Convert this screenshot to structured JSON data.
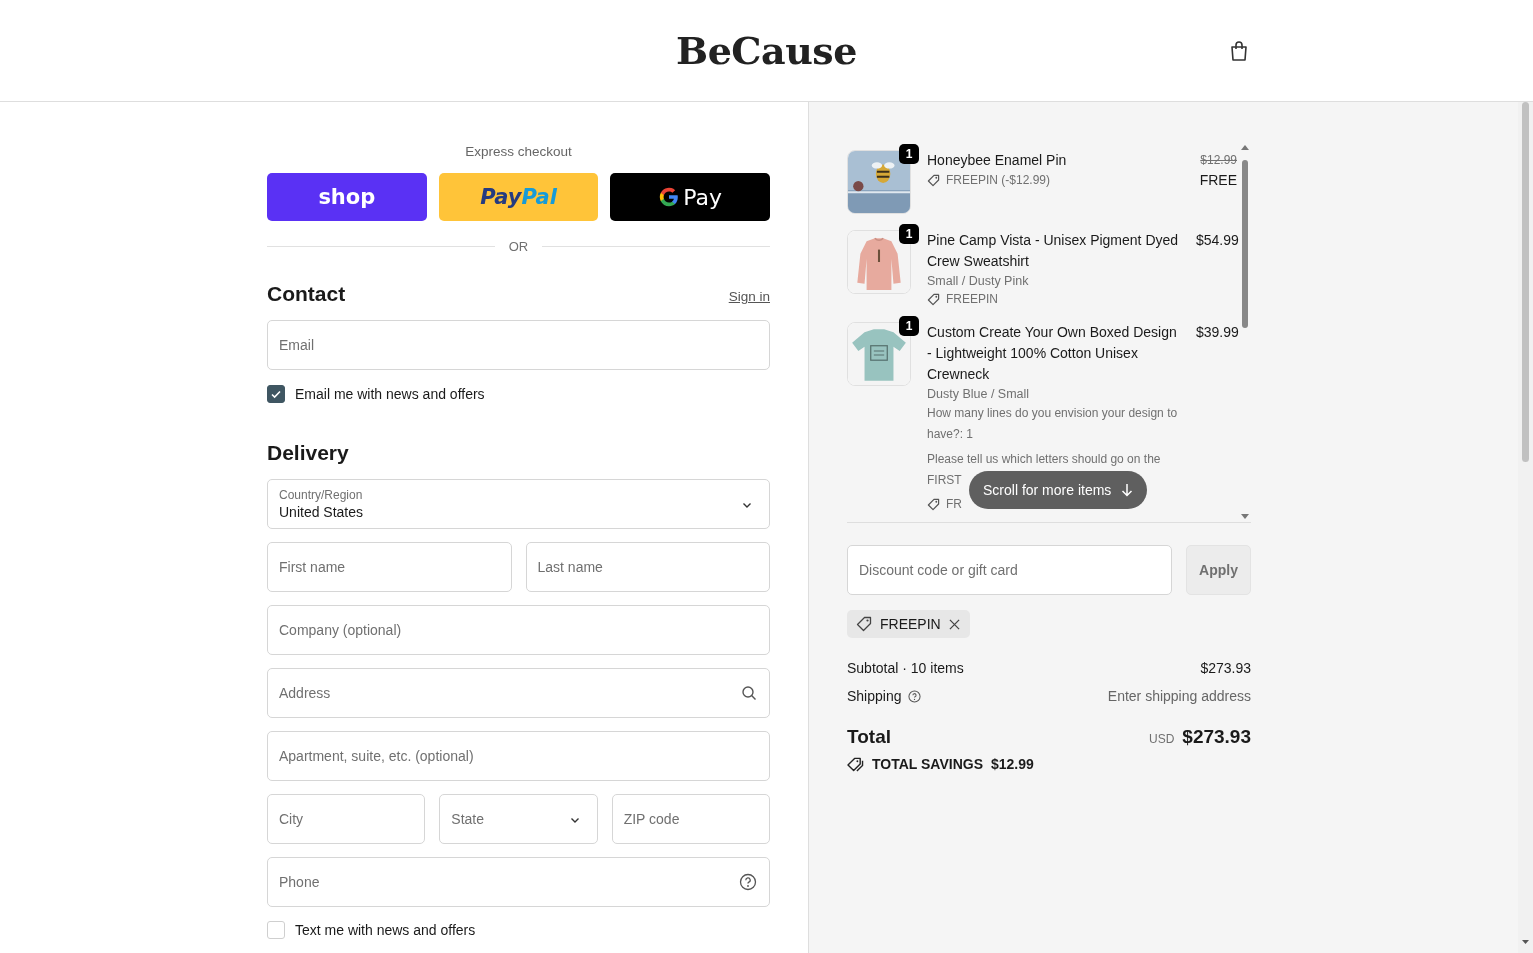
{
  "header": {
    "logo": "BeCause"
  },
  "express": {
    "label": "Express checkout",
    "buttons": [
      {
        "kind": "shop",
        "text": "shop"
      },
      {
        "kind": "paypal",
        "text": "Pay",
        "text2": "Pal"
      },
      {
        "kind": "gpay",
        "text": "Pay"
      }
    ],
    "divider": "OR"
  },
  "contact": {
    "title": "Contact",
    "sign_in": "Sign in",
    "email": {
      "placeholder": "Email"
    },
    "newsletter": {
      "label": "Email me with news and offers",
      "checked": true
    }
  },
  "delivery": {
    "title": "Delivery",
    "country": {
      "label": "Country/Region",
      "value": "United States"
    },
    "rows": [
      [
        {
          "kind": "text",
          "placeholder": "First name"
        },
        {
          "kind": "text",
          "placeholder": "Last name"
        }
      ],
      [
        {
          "kind": "text",
          "placeholder": "Company (optional)"
        }
      ],
      [
        {
          "kind": "search",
          "placeholder": "Address"
        }
      ],
      [
        {
          "kind": "text",
          "placeholder": "Apartment, suite, etc. (optional)"
        }
      ],
      [
        {
          "kind": "text",
          "placeholder": "City"
        },
        {
          "kind": "select",
          "placeholder": "State"
        },
        {
          "kind": "text",
          "placeholder": "ZIP code"
        }
      ],
      [
        {
          "kind": "help",
          "placeholder": "Phone"
        }
      ]
    ],
    "sms": {
      "label": "Text me with news and offers",
      "checked": false
    }
  },
  "order": {
    "items": [
      {
        "quantity": "1",
        "name": "Honeybee Enamel Pin",
        "discount": "FREEPIN (-$12.99)",
        "original_price": "$12.99",
        "price": "FREE"
      },
      {
        "quantity": "1",
        "name": "Pine Camp Vista - Unisex Pigment Dyed Crew Sweatshirt",
        "variant": "Small / Dusty Pink",
        "discount": "FREEPIN",
        "price": "$54.99"
      },
      {
        "quantity": "1",
        "name": "Custom Create Your Own Boxed Design - Lightweight 100% Cotton Unisex Crewneck",
        "variant": "Dusty Blue / Small",
        "notes": [
          "How many lines do you envision your design to have?: 1",
          "Please tell us which letters should go on the FIRST"
        ],
        "discount": "FR",
        "price": "$39.99"
      }
    ],
    "scroll_hint": "Scroll for more items",
    "discount_field": {
      "placeholder": "Discount code or gift card"
    },
    "apply": "Apply",
    "applied_codes": [
      "FREEPIN"
    ],
    "subtotal": {
      "label": "Subtotal · 10 items",
      "value": "$273.93"
    },
    "shipping": {
      "label": "Shipping",
      "value": "Enter shipping address"
    },
    "total": {
      "label": "Total",
      "currency": "USD",
      "value": "$273.93"
    },
    "savings": {
      "label": "TOTAL SAVINGS",
      "value": "$12.99"
    }
  }
}
